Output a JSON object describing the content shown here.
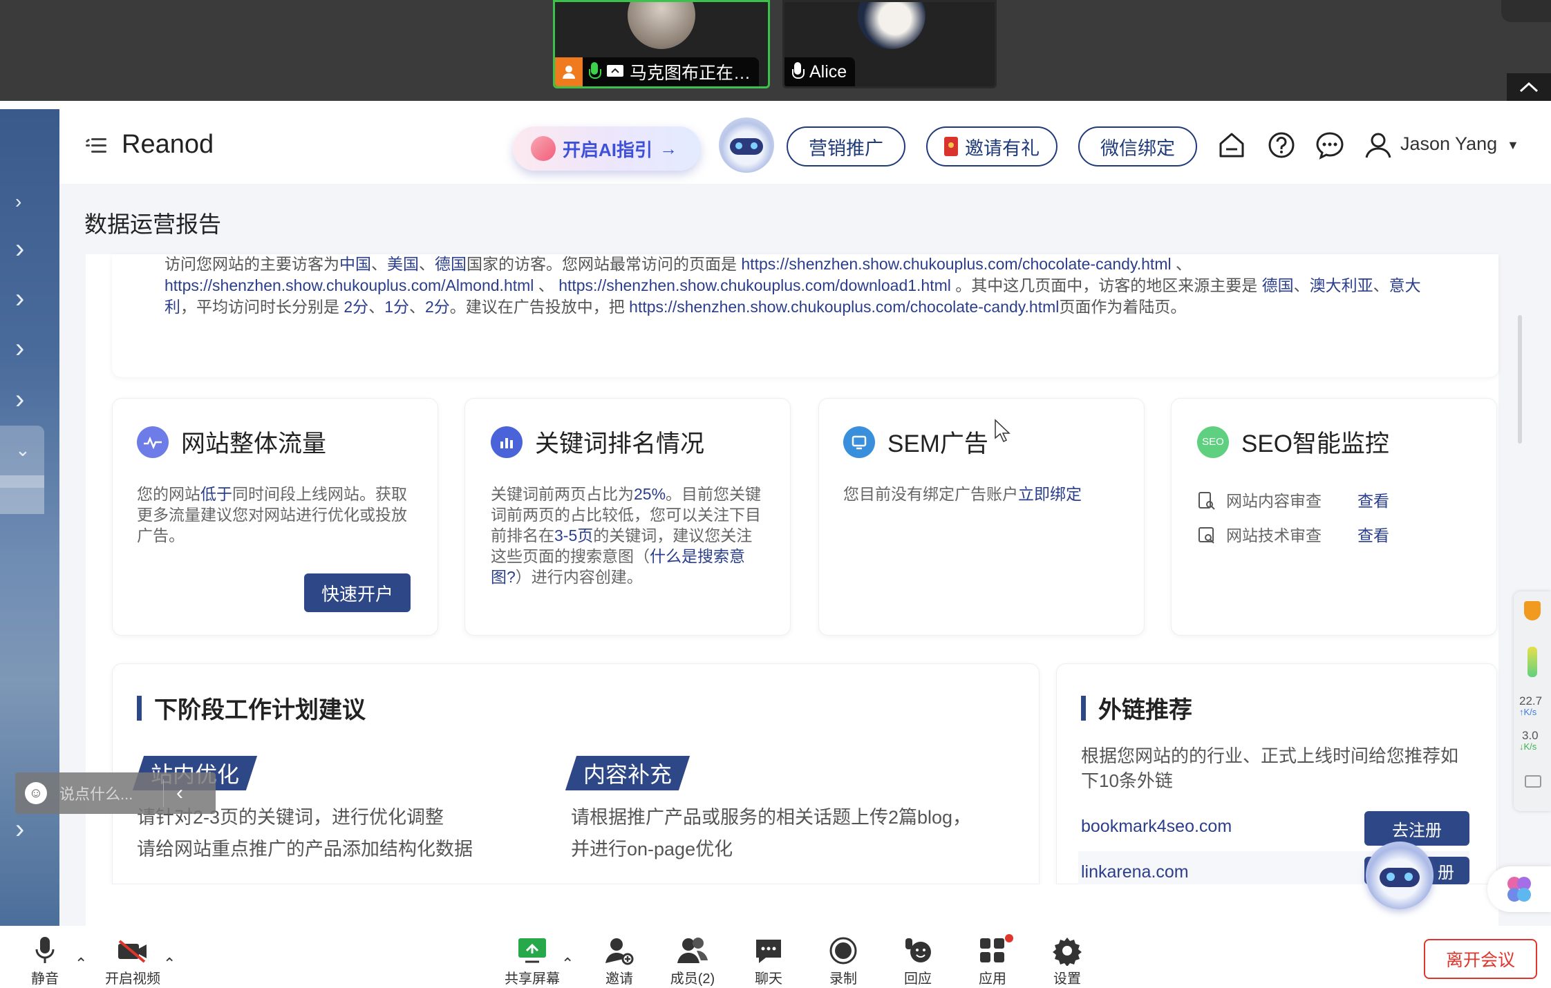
{
  "meeting": {
    "tiles": [
      {
        "name": "马克图布正在…",
        "active": true
      },
      {
        "name": "Alice",
        "active": false
      }
    ]
  },
  "header": {
    "brand": "Reanod",
    "ai_button": "开启AI指引",
    "ai_arrow": "→",
    "pills": [
      "营销推广",
      "邀请有礼",
      "微信绑定"
    ],
    "user": "Jason Yang",
    "colors": {
      "primary": "#2e4787",
      "link": "#2a3e8c",
      "accent_green": "#5fd07f"
    }
  },
  "page": {
    "title": "数据运营报告",
    "summary": {
      "p1": "访问您网站的主要访客为",
      "c1": "中国",
      "sep1": "、",
      "c2": "美国",
      "sep2": "、",
      "c3": "德国",
      "p2": "国家的访客。您网站最常访问的页面是 ",
      "url1": "https://shenzhen.show.chukouplus.com/chocolate-candy.html",
      "p3": " 、",
      "url2": "https://shenzhen.show.chukouplus.com/Almond.html",
      "p4": " 、 ",
      "url3": "https://shenzhen.show.chukouplus.com/download1.html",
      "p5": " 。其中这几页面中，访客的地区来源主要是 ",
      "r1": "德国",
      "sep3": "、",
      "r2": "澳大利亚",
      "sep4": "、",
      "r3": "意大利",
      "p6": "，平均访问时长分别是 ",
      "t1": "2分",
      "sep5": "、",
      "t2": "1分",
      "sep6": "、",
      "t3": "2分",
      "p7": "。建议在广告投放中，把 ",
      "url4": "https://shenzhen.show.chukouplus.com/chocolate-candy.html",
      "p8": "页面作为着陆页。"
    },
    "cards": {
      "traffic": {
        "title": "网站整体流量",
        "t1": "您的网站",
        "hl": "低于",
        "t2": "同时间段上线网站。获取更多流量建议您对网站进行优化或投放广告。",
        "button": "快速开户"
      },
      "keywords": {
        "title": "关键词排名情况",
        "t1": "关键词前两页占比为",
        "hl1": "25%",
        "t2": "。目前您关键词前两页的占比较低，您可以关注下目前排名在",
        "hl2": "3-5页",
        "t3": "的关键词，建议您关注这些页面的搜索意图（",
        "hl3": "什么是搜索意图?",
        "t4": "）进行内容创建。"
      },
      "sem": {
        "title": "SEM广告",
        "t1": "您目前没有绑定广告账户",
        "link": "立即绑定"
      },
      "seo": {
        "title": "SEO智能监控",
        "badge": "SEO",
        "rows": [
          {
            "label": "网站内容审查",
            "action": "查看"
          },
          {
            "label": "网站技术审查",
            "action": "查看"
          }
        ]
      }
    },
    "plan": {
      "title": "下阶段工作计划建议",
      "col1": {
        "tag": "站内优化",
        "lines": [
          "请针对2-3页的关键词，进行优化调整",
          "请给网站重点推广的产品添加结构化数据"
        ]
      },
      "col2": {
        "tag": "内容补充",
        "lines": [
          "请根据推广产品或服务的相关话题上传2篇blog，",
          "并进行on-page优化"
        ]
      }
    },
    "links": {
      "title": "外链推荐",
      "desc": "根据您网站的的行业、正式上线时间给您推荐如下10条外链",
      "items": [
        {
          "site": "bookmark4seo.com",
          "button": "去注册"
        },
        {
          "site": "linkarena.com",
          "button": "册"
        }
      ]
    }
  },
  "overlay": {
    "chat_placeholder": "说点什么...",
    "net_up": "22.7",
    "net_up_unit": "K/s",
    "net_down": "3.0",
    "net_down_unit": "K/s"
  },
  "toolbar": {
    "mute": "静音",
    "video": "开启视频",
    "share": "共享屏幕",
    "invite": "邀请",
    "members": "成员(2)",
    "chat": "聊天",
    "record": "录制",
    "react": "回应",
    "apps": "应用",
    "settings": "设置",
    "leave": "离开会议"
  }
}
